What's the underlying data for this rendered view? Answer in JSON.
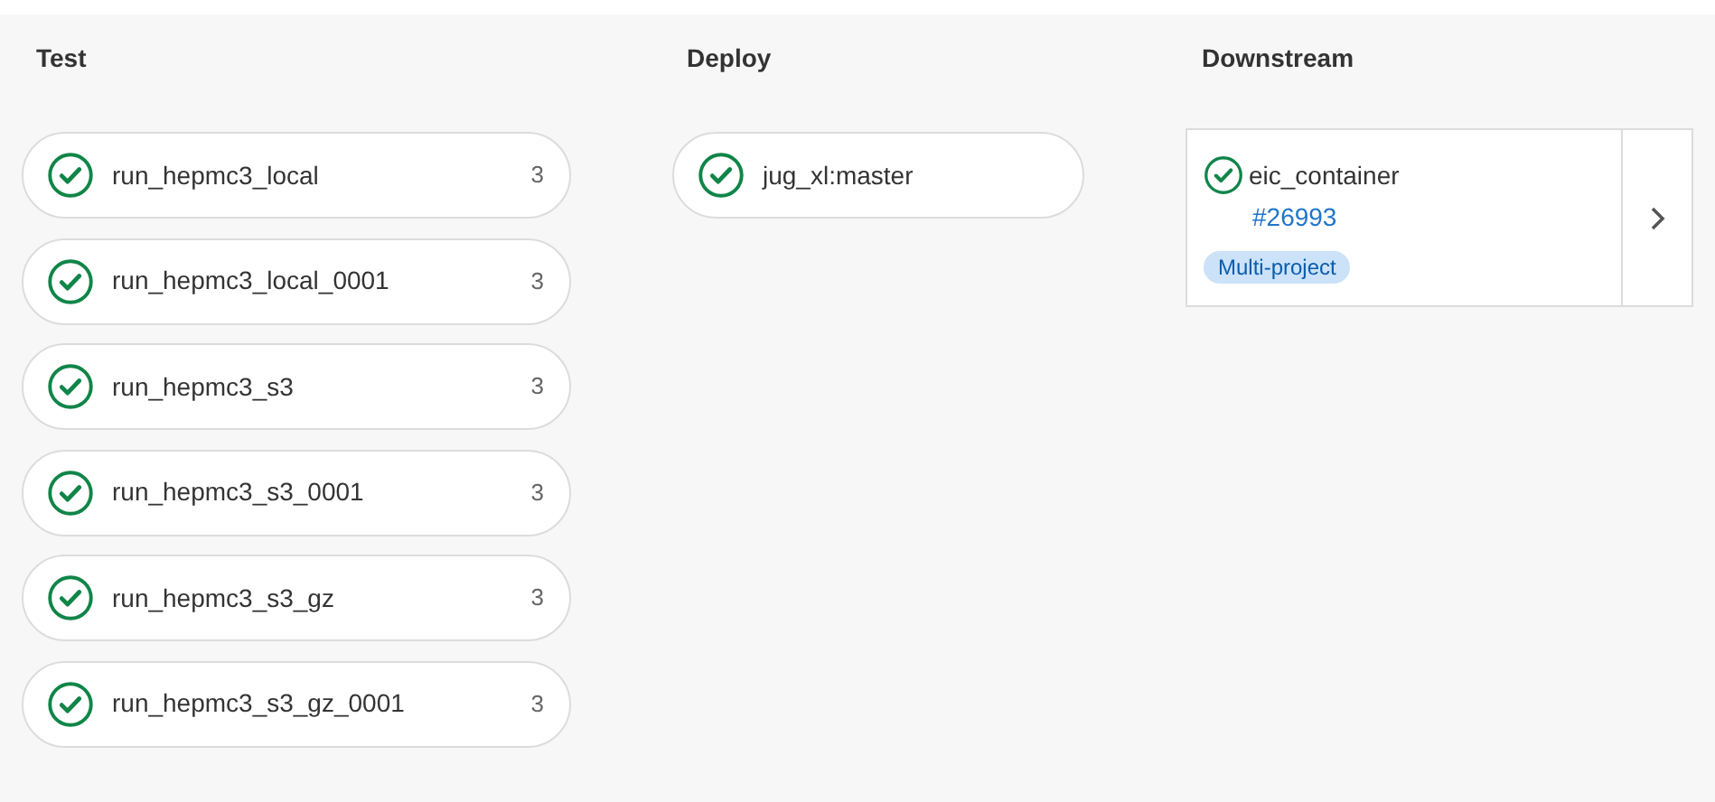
{
  "stages": [
    {
      "title": "Test",
      "jobs": [
        {
          "name": "run_hepmc3_local",
          "passed": true,
          "count": "3"
        },
        {
          "name": "run_hepmc3_local_0001",
          "passed": true,
          "count": "3"
        },
        {
          "name": "run_hepmc3_s3",
          "passed": true,
          "count": "3"
        },
        {
          "name": "run_hepmc3_s3_0001",
          "passed": true,
          "count": "3"
        },
        {
          "name": "run_hepmc3_s3_gz",
          "passed": true,
          "count": "3"
        },
        {
          "name": "run_hepmc3_s3_gz_0001",
          "passed": true,
          "count": "3"
        }
      ]
    },
    {
      "title": "Deploy",
      "jobs": [
        {
          "name": "jug_xl:master",
          "passed": true
        }
      ]
    }
  ],
  "downstream": {
    "title": "Downstream",
    "pipelines": [
      {
        "project": "eic_container",
        "passed": true,
        "id": "#26993",
        "badge": "Multi-project"
      }
    ]
  }
}
